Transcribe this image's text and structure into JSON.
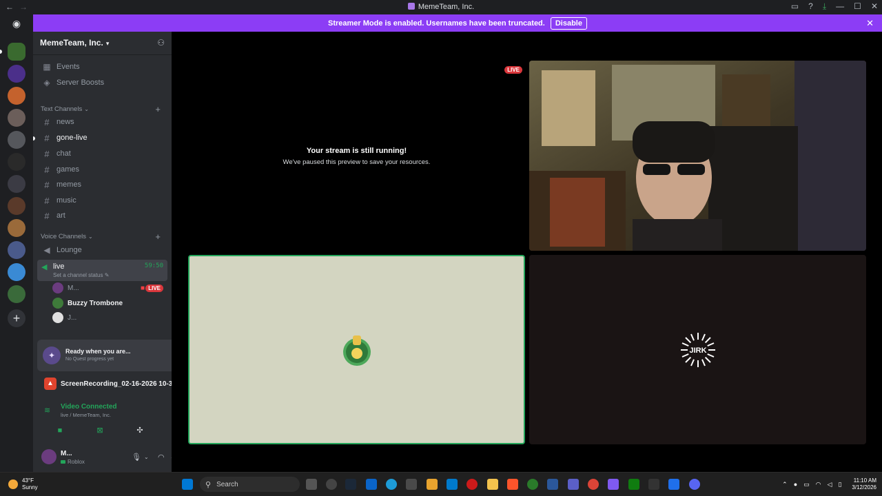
{
  "window": {
    "title": "MemeTeam, Inc."
  },
  "banner": {
    "message": "Streamer Mode is enabled. Usernames have been truncated.",
    "disable_label": "Disable"
  },
  "guild": {
    "name": "MemeTeam, Inc."
  },
  "sidebar": {
    "top_items": [
      {
        "label": "Events",
        "icon": "calendar-icon"
      },
      {
        "label": "Server Boosts",
        "icon": "boost-icon"
      }
    ],
    "text_category": "Text Channels",
    "text_channels": [
      {
        "label": "news",
        "unread": false
      },
      {
        "label": "gone-live",
        "unread": true
      },
      {
        "label": "chat",
        "unread": false
      },
      {
        "label": "games",
        "unread": false
      },
      {
        "label": "memes",
        "unread": false
      },
      {
        "label": "music",
        "unread": false
      },
      {
        "label": "art",
        "unread": false
      }
    ],
    "voice_category": "Voice Channels",
    "voice_channels": [
      {
        "label": "Lounge"
      }
    ],
    "active_voice": {
      "label": "live",
      "timer": "59:50",
      "status_placeholder": "Set a channel status"
    },
    "voice_members": [
      {
        "name": "M...",
        "live": true,
        "live_label": "LIVE",
        "avatar_color": "#6b3c7f"
      },
      {
        "name": "Buzzy Trombone",
        "live": false,
        "avatar_color": "#3e7a3a"
      },
      {
        "name": "J...",
        "live": false,
        "avatar_color": "#e0e0e0"
      }
    ]
  },
  "quest": {
    "title": "Ready when you are...",
    "subtitle": "No Quest progress yet"
  },
  "activity": {
    "label": "ScreenRecording_02-16-2026 10-3..."
  },
  "rtc": {
    "status": "Video Connected",
    "location": "live / MemeTeam, Inc."
  },
  "user": {
    "name": "M...",
    "status": "Roblox"
  },
  "stage": {
    "live_badge": "LIVE",
    "paused_title": "Your stream is still running!",
    "paused_subtitle": "We've paused this preview to save your resources.",
    "tile4_label": "JIRK"
  },
  "taskbar": {
    "weather_temp": "43°F",
    "weather_desc": "Sunny",
    "search_placeholder": "Search",
    "time": "11:10 AM",
    "date": "3/12/2026"
  },
  "colors": {
    "accent_purple": "#8c3df5",
    "online_green": "#23a55a",
    "live_red": "#da373c"
  }
}
